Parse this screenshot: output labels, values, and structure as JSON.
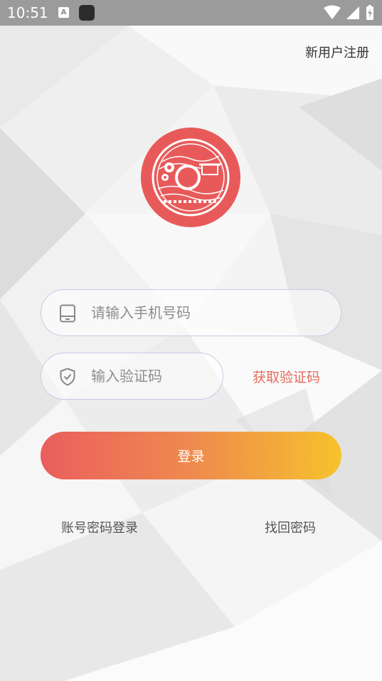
{
  "status_bar": {
    "time": "10:51",
    "notification_icon_letter": "A",
    "icons": [
      "notification-a-icon",
      "app-icon",
      "wifi-icon",
      "signal-icon",
      "battery-icon"
    ]
  },
  "header": {
    "register_label": "新用户注册"
  },
  "logo": {
    "icon": "coin-emblem-logo",
    "color": "#e85a5a"
  },
  "form": {
    "phone": {
      "placeholder": "请输入手机号码",
      "value": "",
      "icon": "phone-icon"
    },
    "code": {
      "placeholder": "输入验证码",
      "value": "",
      "icon": "shield-check-icon"
    },
    "get_code_label": "获取验证码",
    "login_label": "登录"
  },
  "footer_links": {
    "password_login_label": "账号密码登录",
    "forgot_password_label": "找回密码"
  },
  "colors": {
    "accent": "#e56a5d",
    "gradient_start": "#ea5e5e",
    "gradient_end": "#f6c22d",
    "field_border": "#c8cbe6"
  }
}
